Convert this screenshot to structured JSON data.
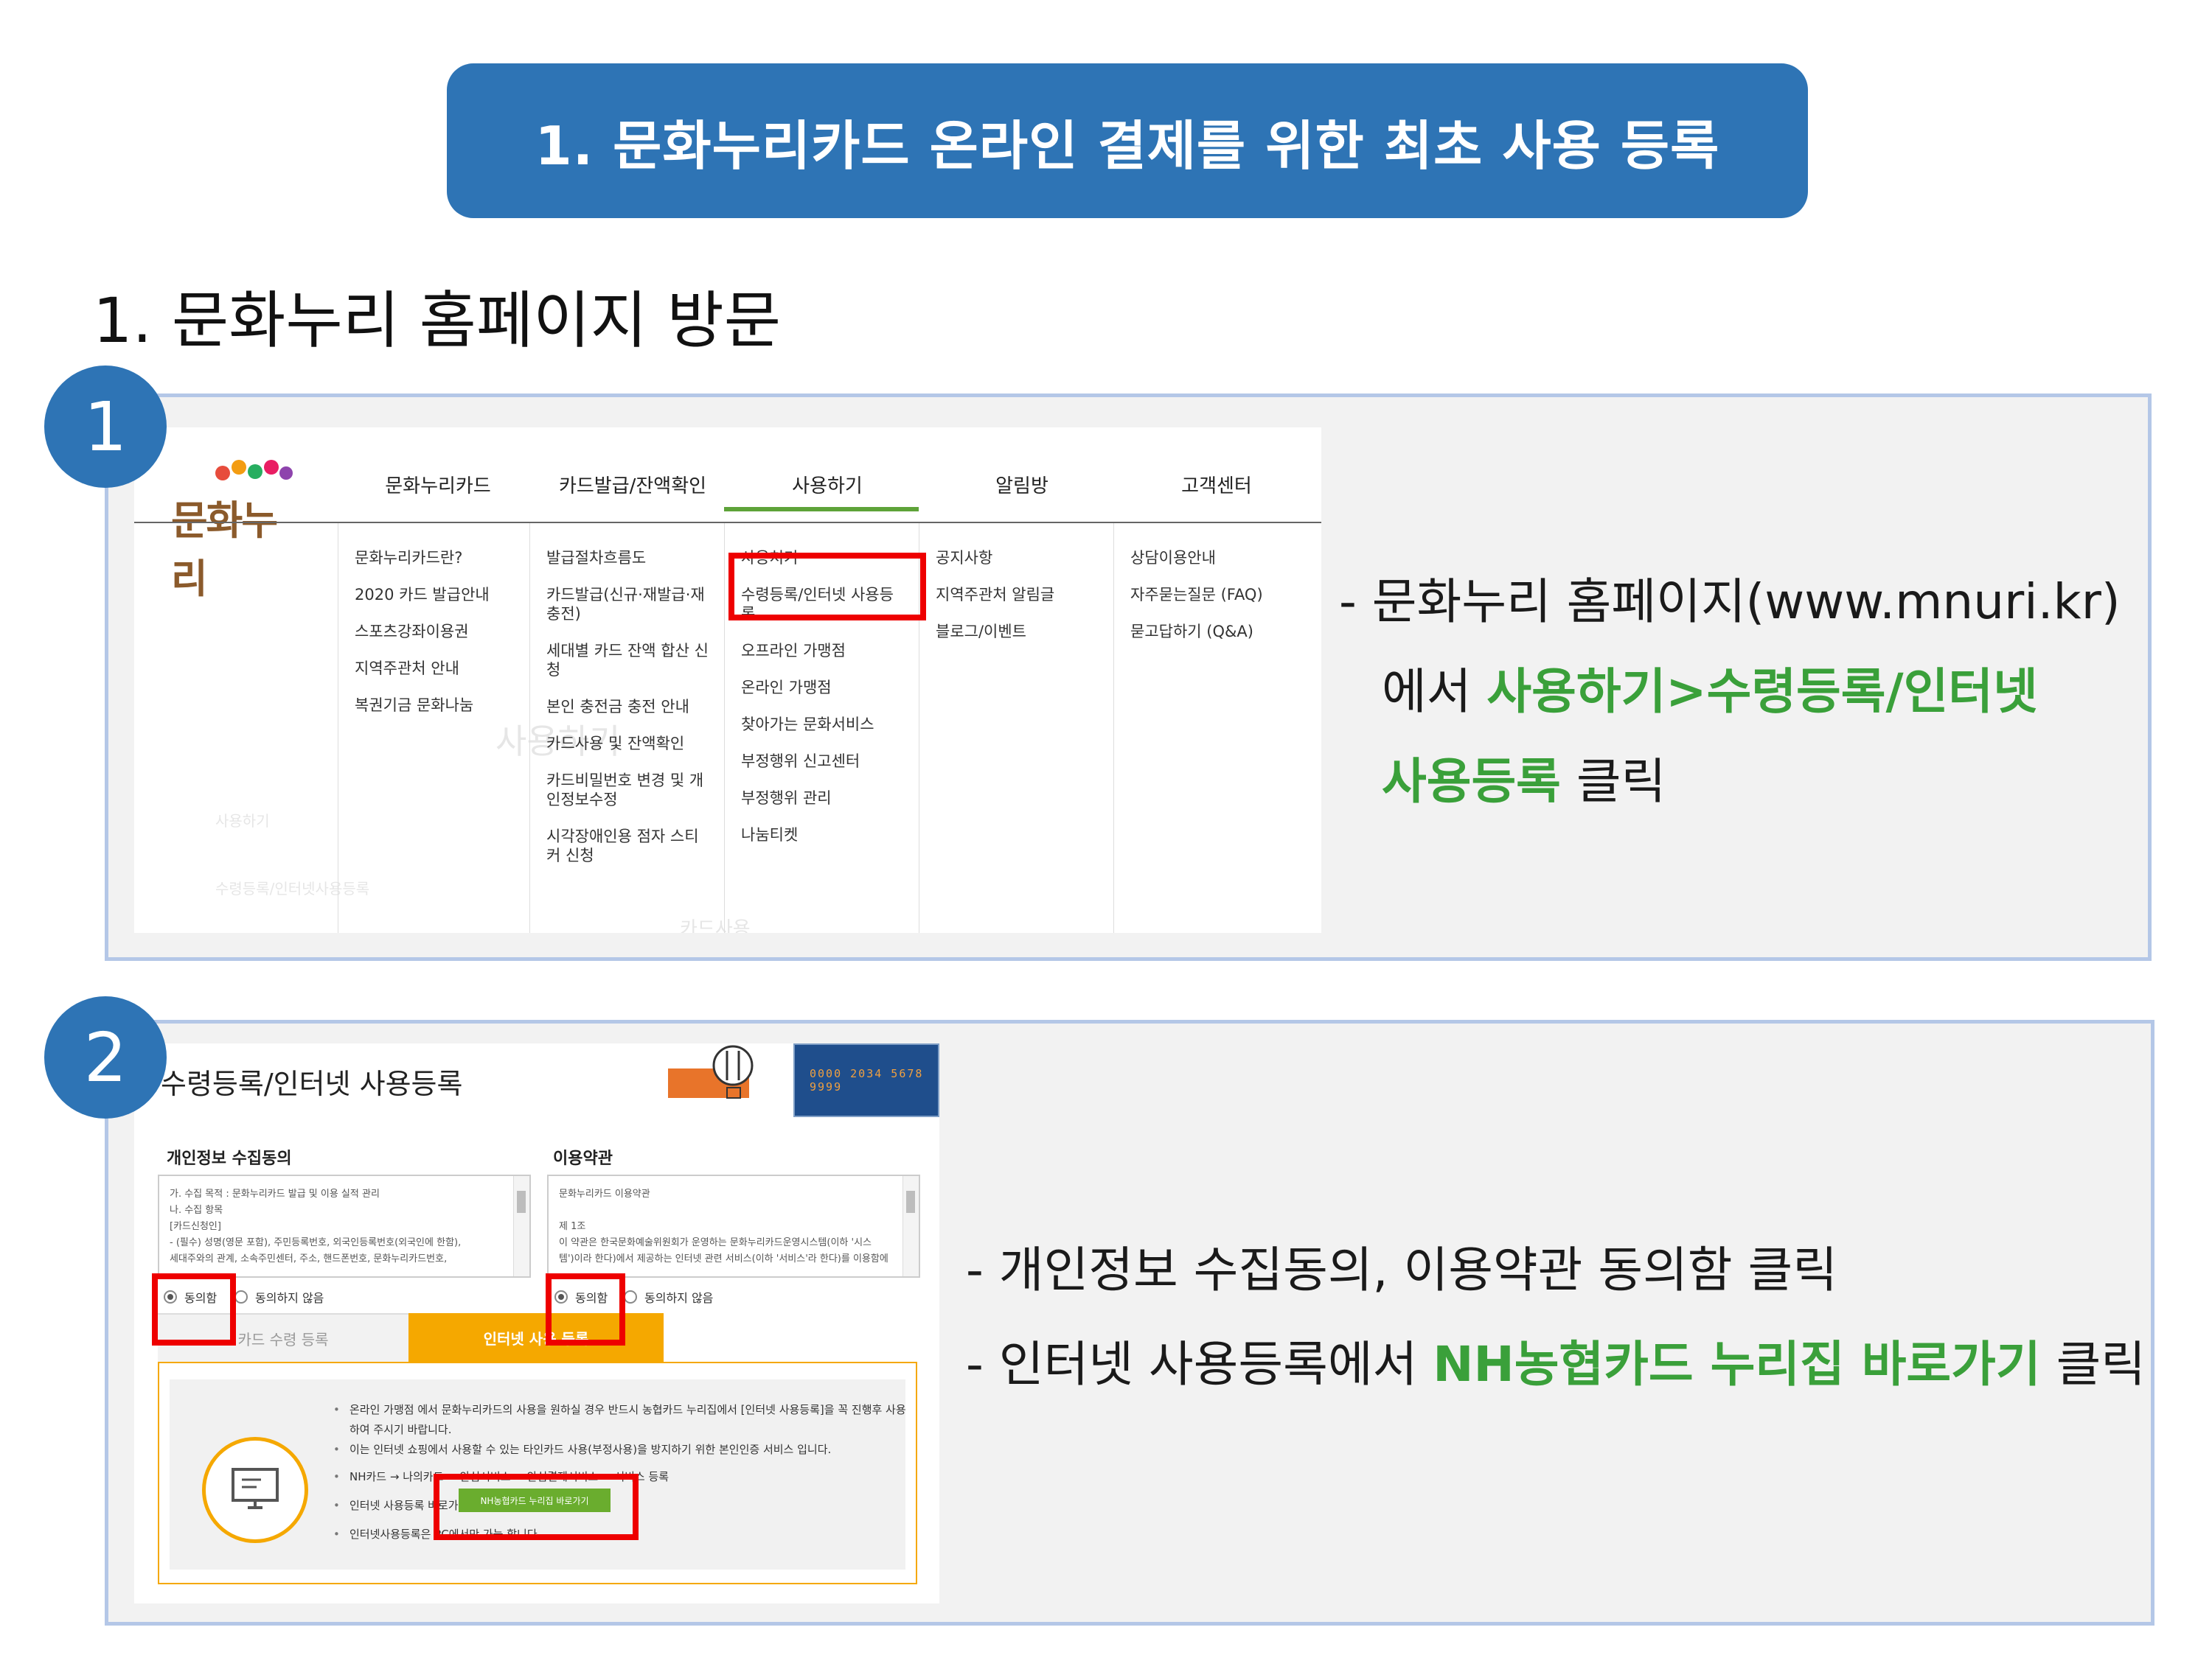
{
  "banner": {
    "title": "1. 문화누리카드 온라인 결제를 위한 최초 사용 등록"
  },
  "step_heading": "1. 문화누리 홈페이지 방문",
  "badges": [
    "1",
    "2"
  ],
  "panel1": {
    "desc_line1": "- 문화누리 홈페이지(www.mnuri.kr)",
    "desc_line2_prefix": "에서 ",
    "desc_line2_highlight": "사용하기>수령등록/인터넷",
    "desc_line3_highlight": "사용등록",
    "desc_line3_suffix": " 클릭"
  },
  "panel2": {
    "line1": "- 개인정보 수집동의, 이용약관 동의함 클릭",
    "line2_prefix": "- 인터넷 사용등록에서 ",
    "line2_highlight": "NH농협카드 누리집 바로가기",
    "line2_suffix": " 클릭"
  },
  "homepage": {
    "logo": "문화누리",
    "nav": [
      "문화누리카드",
      "카드발급/잔액확인",
      "사용하기",
      "알림방",
      "고객센터"
    ],
    "menu_col1": [
      "문화누리카드란?",
      "2020 카드 발급안내",
      "스포츠강좌이용권",
      "지역주관처 안내",
      "복권기금 문화나눔"
    ],
    "menu_col2": [
      "발급절차흐름도",
      "카드발급(신규·재발급·재충전)",
      "세대별 카드 잔액 합산 신청",
      "본인 충전금 충전 안내",
      "카드사용 및 잔액확인",
      "카드비밀번호 변경 및 개인정보수정",
      "시각장애인용 점자 스티커 신청"
    ],
    "menu_col3": [
      "사용처기",
      "수령등록/인터넷 사용등록",
      "오프라인 가맹점",
      "온라인 가맹점",
      "찾아가는 문화서비스",
      "부정행위 신고센터",
      "부정행위 관리",
      "나눔티켓"
    ],
    "menu_col4": [
      "공지사항",
      "지역주관처 알림글",
      "블로그/이벤트"
    ],
    "menu_col5": [
      "상담이용안내",
      "자주묻는질문 (FAQ)",
      "묻고답하기 (Q&A)"
    ],
    "faded_texts": [
      "사용하기",
      "사용하기",
      "수령등록/인터넷사용등록",
      "카드사용"
    ]
  },
  "registration": {
    "title": "수령등록/인터넷 사용등록",
    "card_number": "0000 2034 5678 9999",
    "privacy": {
      "title": "개인정보 수집동의",
      "text": [
        "가. 수집 목적 : 문화누리카드 발급 및 이용 실적 관리",
        "나. 수집 항목",
        "[카드신청인]",
        "- (필수) 성명(영문 포함), 주민등록번호, 외국인등록번호(외국인에 한함),",
        "세대주와의 관계, 소속주민센터, 주소, 핸드폰번호, 문화누리카드번호,"
      ],
      "agree": "동의함",
      "disagree": "동의하지 않음"
    },
    "terms": {
      "title": "이용약관",
      "text": [
        "문화누리카드 이용약관",
        "",
        "제 1조",
        "이 약관은 한국문화예술위원회가 운영하는 문화누리카드운영시스템(이하 '시스",
        "템')이라 한다)에서 제공하는 인터넷 관련 서비스(이하 '서비스'라 한다)를 이용함에"
      ],
      "agree": "동의함",
      "disagree": "동의하지 않음"
    },
    "tabs": [
      "카드 수령 등록",
      "인터넷 사용 등록"
    ],
    "bullets": [
      "온라인 가맹점 에서 문화누리카드의 사용을 원하실 경우 반드시 농협카드 누리집에서 [인터넷 사용등록]을 꼭 진행후 사용하여 주시기 바랍니다.",
      "이는 인터넷 쇼핑에서 사용할 수 있는 타인카드 사용(부정사용)을 방지하기 위한 본인인증 서비스 입니다.",
      "NH카드 → 나의카드 → 안심서비스 → 안심결제서비스 → 서비스 등록",
      "인터넷 사용등록 바로가기",
      "인터넷사용등록은 PC에서만 가능 합니다."
    ],
    "nh_button": "NH농협카드 누리집 바로가기"
  },
  "colors": {
    "accent_blue": "#2e74b5",
    "highlight_green": "#3aa03a",
    "callout_red": "#ee0000",
    "tab_orange": "#f5a800"
  }
}
